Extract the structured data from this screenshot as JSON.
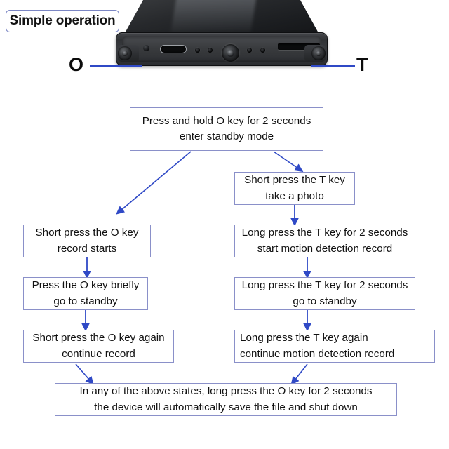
{
  "title": {
    "label": "Simple operation"
  },
  "device": {
    "key_labels": {
      "left": "O",
      "right": "T"
    },
    "parts": [
      "reset-pinhole",
      "usb-c-port",
      "indicator-led",
      "camera-lens",
      "memory-card-slot",
      "o-button",
      "t-button"
    ]
  },
  "colors": {
    "box_border": "#8a90c9",
    "arrow": "#2f49c6",
    "title_border": "#7b86c4",
    "text": "#111111",
    "background": "#ffffff"
  },
  "flow": {
    "start": {
      "lines": [
        "Press and hold O key for 2 seconds",
        "enter standby mode"
      ]
    },
    "photo": {
      "lines": [
        "Short press the T key",
        "take a photo"
      ]
    },
    "left": [
      {
        "lines": [
          "Short press the O key",
          "record starts"
        ]
      },
      {
        "lines": [
          "Press the O key briefly",
          "go to standby"
        ]
      },
      {
        "lines": [
          "Short press the O key again",
          "continue record"
        ]
      }
    ],
    "right": [
      {
        "lines": [
          "Long press the T key for 2 seconds",
          "start motion detection record"
        ]
      },
      {
        "lines": [
          "Long press the T key for 2 seconds",
          "go to standby"
        ]
      },
      {
        "lines": [
          "Long press the T key again",
          "continue motion detection record"
        ]
      }
    ],
    "final": {
      "lines": [
        "In any of the above states, long press the O key for 2 seconds",
        "the device will automatically save the file and shut down"
      ]
    }
  }
}
